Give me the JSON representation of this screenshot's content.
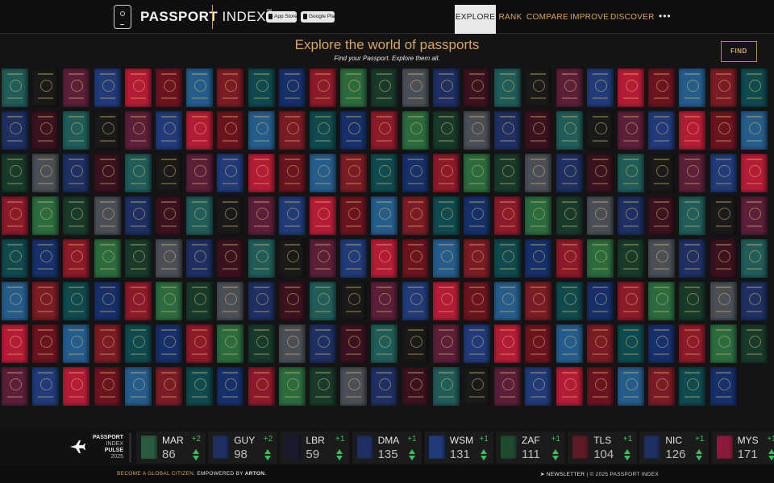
{
  "header": {
    "brand_bold": "PASSPORT",
    "brand_thin": "INDEX",
    "brand_tm": "™",
    "app_store_label": "App Store",
    "google_play_label": "Google Play",
    "nav": [
      {
        "label": "EXPLORE",
        "active": true
      },
      {
        "label": "RANK",
        "active": false
      },
      {
        "label": "COMPARE",
        "active": false
      },
      {
        "label": "IMPROVE",
        "active": false
      },
      {
        "label": "DISCOVER",
        "active": false
      }
    ],
    "more_label": "•••"
  },
  "hero": {
    "title": "Explore the world of passports",
    "subtitle": "Find your Passport. Explore them all.",
    "find_label": "FIND"
  },
  "passports": {
    "count": 199,
    "palette": [
      "#1f5c5a",
      "#7a1b26",
      "#1d2f63",
      "#6b1420",
      "#183a2c",
      "#203a7a",
      "#8c1a2b",
      "#1a1a1a",
      "#0e4a4f",
      "#3a1220",
      "#245c8c",
      "#4a4f57",
      "#b31b36",
      "#2a6b3f",
      "#5c1f3a",
      "#16306b"
    ]
  },
  "pulse": {
    "line1": "PASSPORT",
    "line2": "INDEX",
    "line3": "PULSE",
    "year": "2025",
    "tiles": [
      {
        "code": "MAR",
        "delta": "+2",
        "score": "86",
        "color": "#2a5c3f"
      },
      {
        "code": "GUY",
        "delta": "+2",
        "score": "98",
        "color": "#1d2f63"
      },
      {
        "code": "LBR",
        "delta": "+1",
        "score": "59",
        "color": "#1a1a2e"
      },
      {
        "code": "DMA",
        "delta": "+1",
        "score": "135",
        "color": "#1d2f63"
      },
      {
        "code": "WSM",
        "delta": "+1",
        "score": "131",
        "color": "#203a7a"
      },
      {
        "code": "ZAF",
        "delta": "+1",
        "score": "111",
        "color": "#1f4a2c"
      },
      {
        "code": "TLS",
        "delta": "+1",
        "score": "104",
        "color": "#5c1a26"
      },
      {
        "code": "NIC",
        "delta": "+1",
        "score": "126",
        "color": "#1d2f63"
      },
      {
        "code": "MYS",
        "delta": "+1",
        "score": "171",
        "color": "#8c1a3b"
      }
    ]
  },
  "footer": {
    "tagline": "BECOME A GLOBAL CITIZEN.",
    "empowered": "EMPOWERED BY",
    "arton": "ARTON.",
    "newsletter": "NEWSLETTER",
    "copyright": "| © 2025 PASSPORT INDEX"
  }
}
